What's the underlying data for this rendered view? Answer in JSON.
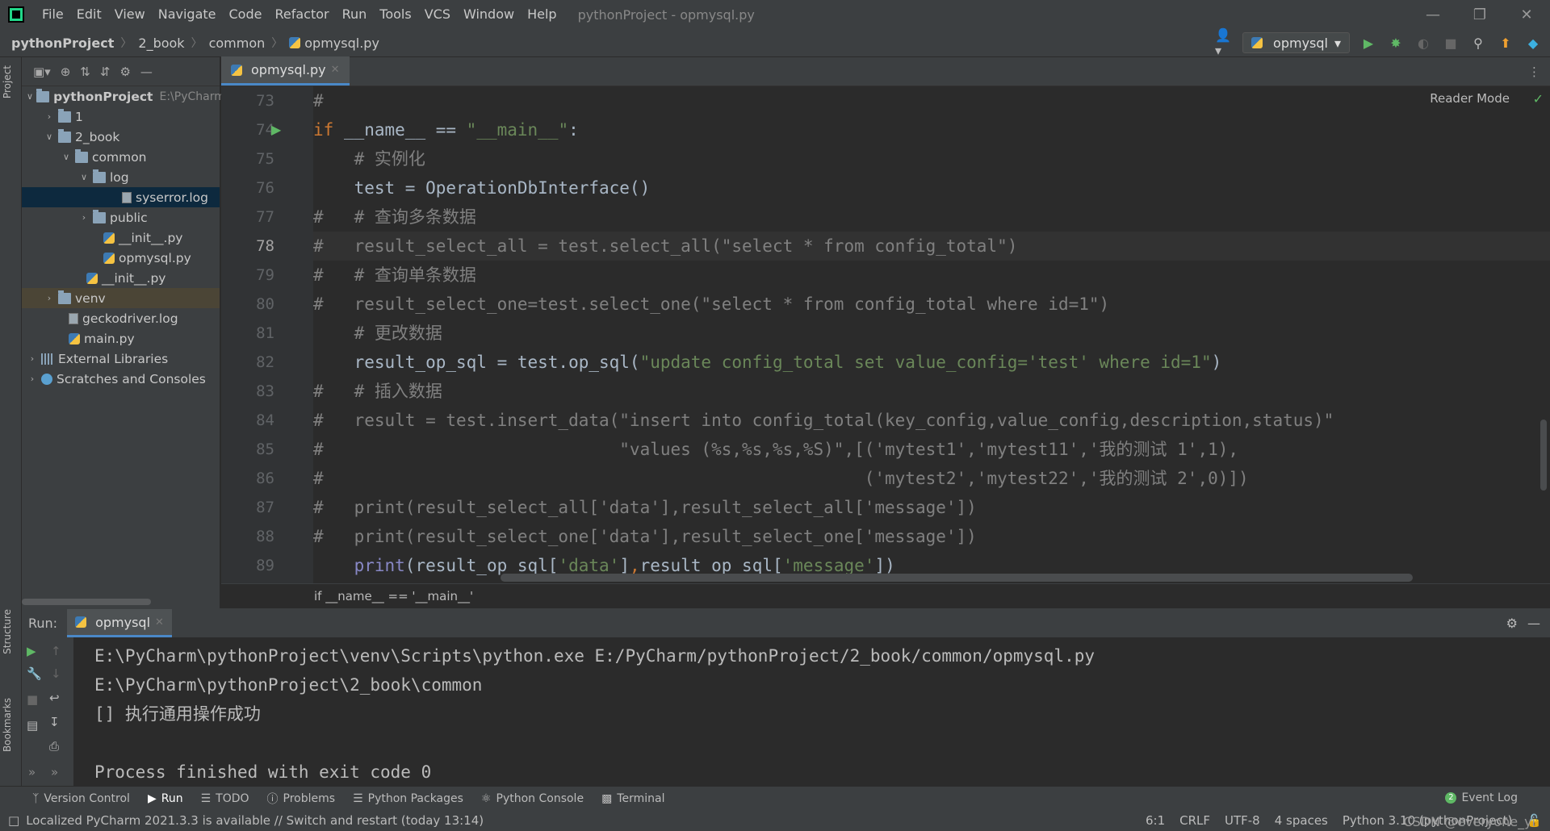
{
  "menubar": {
    "items": [
      "File",
      "Edit",
      "View",
      "Navigate",
      "Code",
      "Refactor",
      "Run",
      "Tools",
      "VCS",
      "Window",
      "Help"
    ],
    "title": "pythonProject - opmysql.py"
  },
  "navbar": {
    "crumbs": [
      "pythonProject",
      "2_book",
      "common",
      "opmysql.py"
    ],
    "run_config": "opmysql"
  },
  "sidebar": {
    "project_tab": "Project",
    "structure_tab": "Structure",
    "bookmarks_tab": "Bookmarks"
  },
  "tree": {
    "root": "pythonProject",
    "root_path": "E:\\PyCharm",
    "items": [
      "1",
      "2_book",
      "common",
      "log",
      "syserror.log",
      "public",
      "__init__.py",
      "opmysql.py",
      "__init__.py",
      "venv",
      "geckodriver.log",
      "main.py",
      "External Libraries",
      "Scratches and Consoles"
    ]
  },
  "editor": {
    "tab": "opmysql.py",
    "reader_mode": "Reader Mode",
    "breadcrumb": "if __name__ == '__main__'",
    "line_numbers": [
      "73",
      "74",
      "75",
      "76",
      "77",
      "78",
      "79",
      "80",
      "81",
      "82",
      "83",
      "84",
      "85",
      "86",
      "87",
      "88",
      "89"
    ]
  },
  "run": {
    "label": "Run:",
    "tab": "opmysql",
    "output": [
      "E:\\PyCharm\\pythonProject\\venv\\Scripts\\python.exe E:/PyCharm/pythonProject/2_book/common/opmysql.py",
      "E:\\PyCharm\\pythonProject\\2_book\\common",
      "[] 执行通用操作成功",
      "",
      "Process finished with exit code 0"
    ]
  },
  "bottom_tabs": [
    "Version Control",
    "Run",
    "TODO",
    "Problems",
    "Python Packages",
    "Python Console",
    "Terminal"
  ],
  "event_log": "Event Log",
  "event_log_count": "2",
  "status": {
    "message": "Localized PyCharm 2021.3.3 is available // Switch and restart (today 13:14)",
    "position": "6:1",
    "line_sep": "CRLF",
    "encoding": "UTF-8",
    "indent": "4 spaces",
    "interpreter": "Python 3.10 (pythonProject)"
  },
  "watermark": "CSDN @everyone_yi",
  "colors": {
    "keyword": "#cc7832",
    "string": "#6a8759",
    "comment": "#808080",
    "accent": "#4a88c7"
  }
}
